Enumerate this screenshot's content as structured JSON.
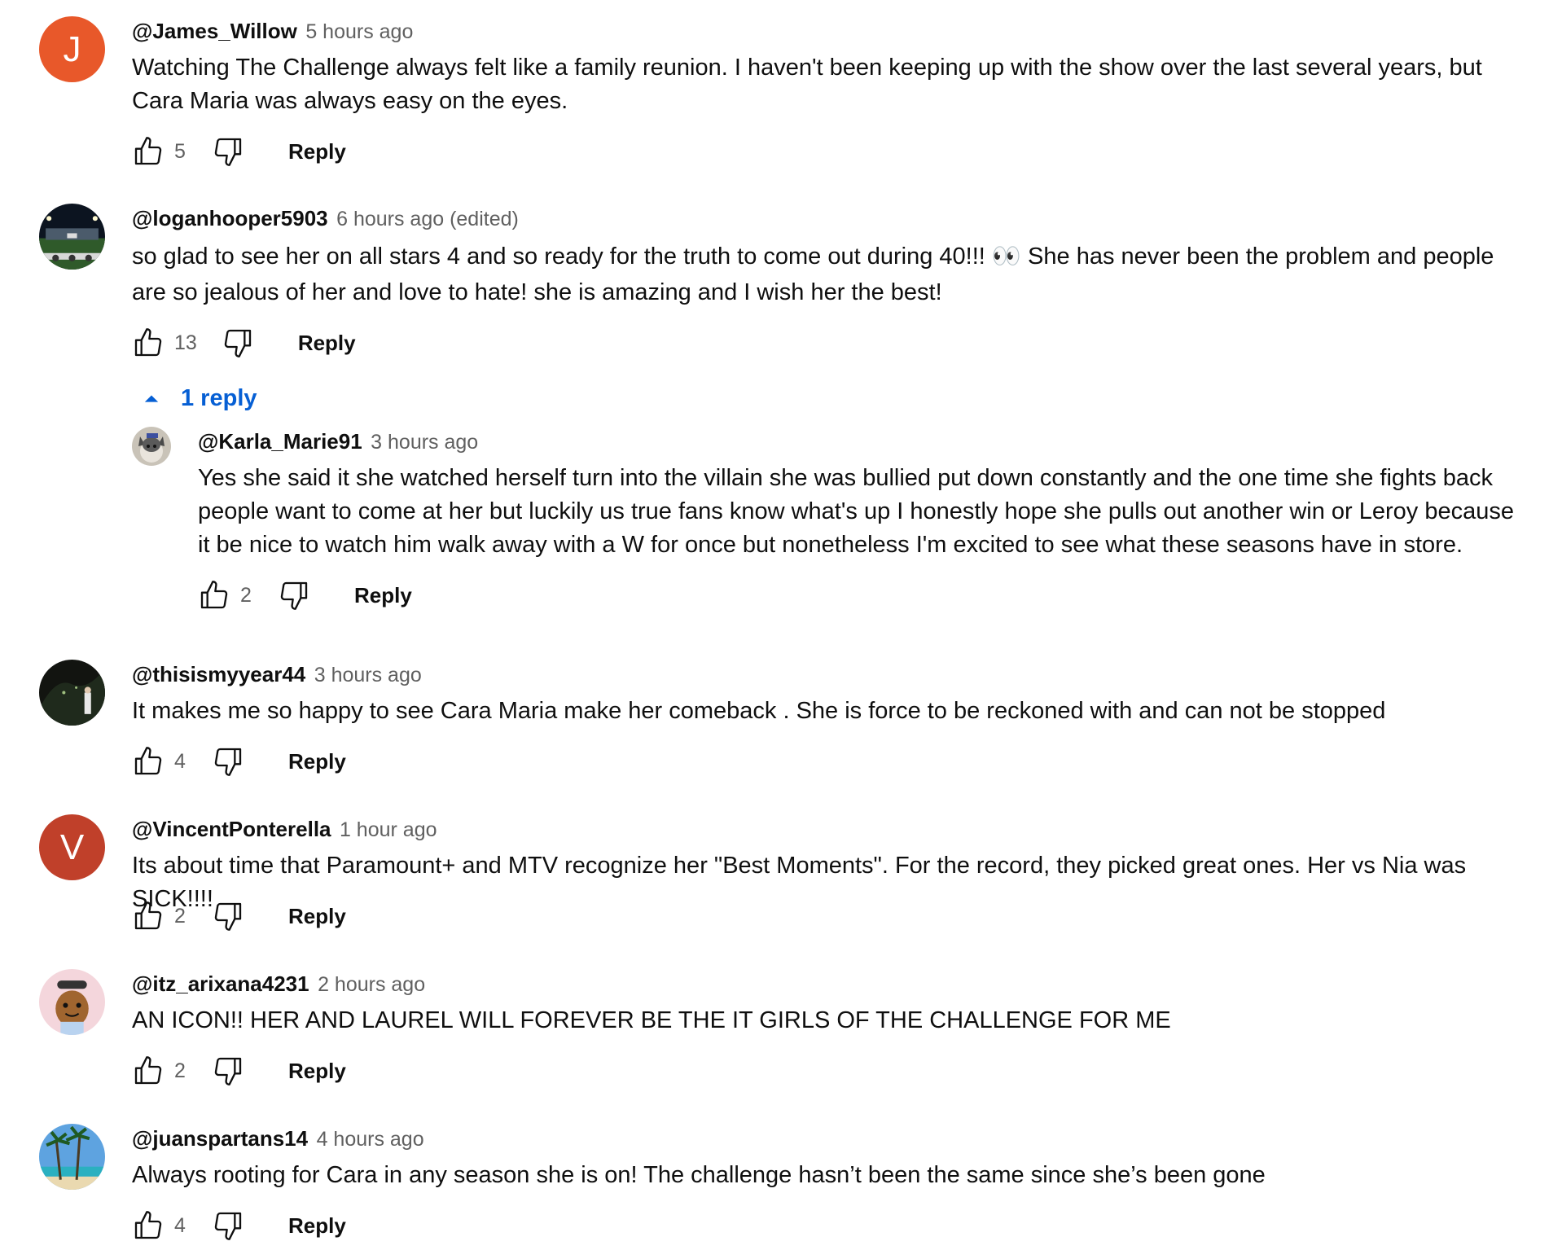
{
  "comments": [
    {
      "author": "@James_Willow",
      "time": "5 hours ago",
      "avatar_letter": "J",
      "avatar_color": "#e8582a",
      "text": "Watching The Challenge always felt like a family reunion. I haven't been keeping up with the show over the last several years, but Cara Maria was always easy on the eyes.",
      "likes": "5",
      "reply_label": "Reply"
    },
    {
      "author": "@loganhooper5903",
      "time": "6 hours ago (edited)",
      "avatar_icon": "stadium-photo-avatar",
      "text": "so glad to see her on all stars 4 and so ready for the truth to come out during 40!!! 👀 She has never been the problem and people are so jealous of her and love to hate! she is amazing and I wish her the best!",
      "likes": "13",
      "reply_label": "Reply",
      "replies_toggle": "1 reply",
      "replies": [
        {
          "author": "@Karla_Marie91",
          "time": "3 hours ago",
          "avatar_icon": "dog-photo-avatar",
          "text": "Yes she said it she watched herself turn into the villain she was bullied put down constantly and the one time she fights back people want to come at her but luckily us true fans know what's up I honestly hope she pulls out another win or Leroy because it be nice to watch him walk away with a W for once but nonetheless I'm excited to see what these seasons have in store.",
          "likes": "2",
          "reply_label": "Reply"
        }
      ]
    },
    {
      "author": "@thisismyyear44",
      "time": "3 hours ago",
      "avatar_icon": "night-photo-avatar",
      "text": "It makes me so happy to see Cara Maria make her comeback . She is force to be reckoned with and can not be stopped",
      "likes": "4",
      "reply_label": "Reply"
    },
    {
      "author": "@VincentPonterella",
      "time": "1 hour ago",
      "avatar_letter": "V",
      "avatar_color": "#c0402a",
      "text": "Its about time that Paramount+ and MTV recognize her \"Best Moments\". For the record, they picked great ones. Her vs Nia was SICK!!!!",
      "likes": "2",
      "reply_label": "Reply"
    },
    {
      "author": "@itz_arixana4231",
      "time": "2 hours ago",
      "avatar_icon": "character-avatar",
      "text": "AN ICON!! HER AND LAUREL WILL FOREVER BE THE IT GIRLS OF THE CHALLENGE FOR ME",
      "likes": "2",
      "reply_label": "Reply"
    },
    {
      "author": "@juanspartans14",
      "time": "4 hours ago",
      "avatar_icon": "palm-trees-photo-avatar",
      "text": "Always rooting for Cara in any season she is on! The challenge hasn’t been the same since she’s been gone",
      "likes": "4",
      "reply_label": "Reply"
    }
  ],
  "colors": {
    "link_blue": "#065fd4",
    "secondary_text": "#606060",
    "primary_text": "#0f0f0f"
  }
}
